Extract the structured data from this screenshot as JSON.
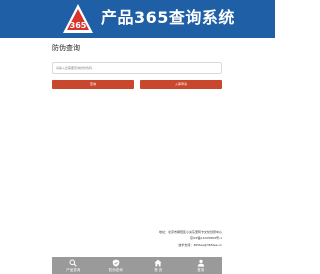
{
  "header": {
    "title": "产品365查询系统",
    "logo": {
      "text": "365",
      "icon": "triangle-365-logo-icon"
    }
  },
  "main": {
    "section_title": "防伪查询",
    "input": {
      "placeholder": "请输入您需要查询的防伪码",
      "value": ""
    },
    "query_button": "查询",
    "stock_button": "入库申请"
  },
  "footer": {
    "address": "地址：北京市朝阳区小关东里阿卡文化创意中心",
    "icp": "京ICP备11005869号-1",
    "contact": "技术支持：365tea@365tea.cn"
  },
  "tabbar": [
    {
      "label": "产品查询",
      "icon": "search-icon"
    },
    {
      "label": "防伪查询",
      "icon": "shield-icon"
    },
    {
      "label": "首 页",
      "icon": "home-icon"
    },
    {
      "label": "登录",
      "icon": "user-icon"
    }
  ],
  "colors": {
    "header_bg": "#1e5fa5",
    "button_bg": "#c9472c",
    "tabbar_bg": "#9a9a9a"
  }
}
